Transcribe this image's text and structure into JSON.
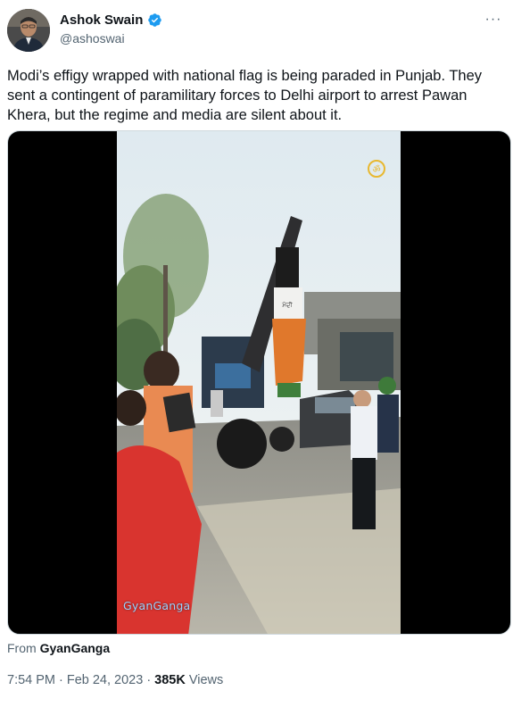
{
  "author": {
    "display_name": "Ashok Swain",
    "handle": "@ashoswai",
    "verified": true
  },
  "tweet": {
    "text": "Modi’s effigy wrapped with national flag is being paraded in Punjab. They sent a contingent of paramilitary forces to Delhi airport to arrest Pawan Khera, but the regime and media are silent about it."
  },
  "media": {
    "watermark_bottom": "GyanGanga",
    "effigy_sign": "ਮੋਦੀ"
  },
  "source": {
    "prefix": "From",
    "name": "GyanGanga"
  },
  "meta": {
    "time": "7:54 PM",
    "separator1": "·",
    "date": "Feb 24, 2023",
    "separator2": "·",
    "views_count": "385K",
    "views_label": "Views"
  },
  "icons": {
    "more": "more-dots-icon",
    "verified": "verified-badge-icon"
  },
  "colors": {
    "verified_blue": "#1d9bf0",
    "secondary_text": "#536471",
    "primary_text": "#0f1419"
  }
}
